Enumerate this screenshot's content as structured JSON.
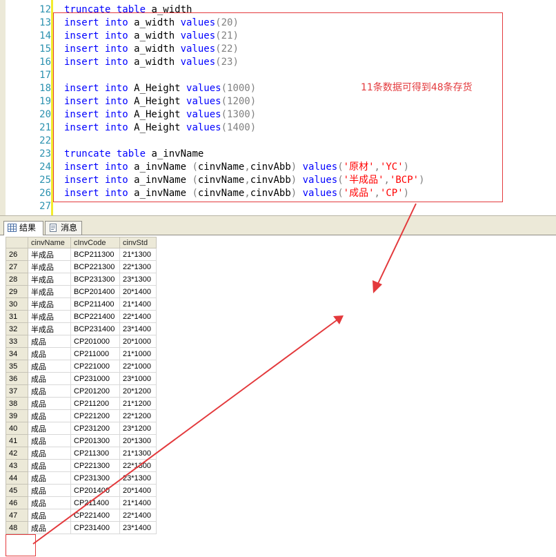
{
  "editor": {
    "lines": [
      {
        "num": "12",
        "parts": [
          {
            "t": "truncate table",
            "c": "kw"
          },
          {
            "t": " a_width",
            "c": ""
          }
        ]
      },
      {
        "num": "13",
        "parts": [
          {
            "t": "insert into",
            "c": "kw"
          },
          {
            "t": " a_width ",
            "c": ""
          },
          {
            "t": "values",
            "c": "kw"
          },
          {
            "t": "(20)",
            "c": "gr"
          }
        ]
      },
      {
        "num": "14",
        "parts": [
          {
            "t": "insert into",
            "c": "kw"
          },
          {
            "t": " a_width ",
            "c": ""
          },
          {
            "t": "values",
            "c": "kw"
          },
          {
            "t": "(21)",
            "c": "gr"
          }
        ]
      },
      {
        "num": "15",
        "parts": [
          {
            "t": "insert into",
            "c": "kw"
          },
          {
            "t": " a_width ",
            "c": ""
          },
          {
            "t": "values",
            "c": "kw"
          },
          {
            "t": "(22)",
            "c": "gr"
          }
        ]
      },
      {
        "num": "16",
        "parts": [
          {
            "t": "insert into",
            "c": "kw"
          },
          {
            "t": " a_width ",
            "c": ""
          },
          {
            "t": "values",
            "c": "kw"
          },
          {
            "t": "(23)",
            "c": "gr"
          }
        ]
      },
      {
        "num": "17",
        "parts": []
      },
      {
        "num": "18",
        "parts": [
          {
            "t": "insert into",
            "c": "kw"
          },
          {
            "t": " A_Height ",
            "c": ""
          },
          {
            "t": "values",
            "c": "kw"
          },
          {
            "t": "(1000)",
            "c": "gr"
          }
        ]
      },
      {
        "num": "19",
        "parts": [
          {
            "t": "insert into",
            "c": "kw"
          },
          {
            "t": " A_Height ",
            "c": ""
          },
          {
            "t": "values",
            "c": "kw"
          },
          {
            "t": "(1200)",
            "c": "gr"
          }
        ]
      },
      {
        "num": "20",
        "parts": [
          {
            "t": "insert into",
            "c": "kw"
          },
          {
            "t": " A_Height ",
            "c": ""
          },
          {
            "t": "values",
            "c": "kw"
          },
          {
            "t": "(1300)",
            "c": "gr"
          }
        ]
      },
      {
        "num": "21",
        "parts": [
          {
            "t": "insert into",
            "c": "kw"
          },
          {
            "t": " A_Height ",
            "c": ""
          },
          {
            "t": "values",
            "c": "kw"
          },
          {
            "t": "(1400)",
            "c": "gr"
          }
        ]
      },
      {
        "num": "22",
        "parts": []
      },
      {
        "num": "23",
        "parts": [
          {
            "t": "truncate table",
            "c": "kw"
          },
          {
            "t": " a_invName",
            "c": ""
          }
        ]
      },
      {
        "num": "24",
        "parts": [
          {
            "t": "insert into",
            "c": "kw"
          },
          {
            "t": " a_invName ",
            "c": ""
          },
          {
            "t": "(",
            "c": "gr"
          },
          {
            "t": "cinvName",
            "c": ""
          },
          {
            "t": ",",
            "c": "gr"
          },
          {
            "t": "cinvAbb",
            "c": ""
          },
          {
            "t": ") ",
            "c": "gr"
          },
          {
            "t": "values",
            "c": "kw"
          },
          {
            "t": "(",
            "c": "gr"
          },
          {
            "t": "'原材'",
            "c": "str"
          },
          {
            "t": ",",
            "c": "gr"
          },
          {
            "t": "'YC'",
            "c": "str"
          },
          {
            "t": ")",
            "c": "gr"
          }
        ]
      },
      {
        "num": "25",
        "parts": [
          {
            "t": "insert into",
            "c": "kw"
          },
          {
            "t": " a_invName ",
            "c": ""
          },
          {
            "t": "(",
            "c": "gr"
          },
          {
            "t": "cinvName",
            "c": ""
          },
          {
            "t": ",",
            "c": "gr"
          },
          {
            "t": "cinvAbb",
            "c": ""
          },
          {
            "t": ") ",
            "c": "gr"
          },
          {
            "t": "values",
            "c": "kw"
          },
          {
            "t": "(",
            "c": "gr"
          },
          {
            "t": "'半成品'",
            "c": "str"
          },
          {
            "t": ",",
            "c": "gr"
          },
          {
            "t": "'BCP'",
            "c": "str"
          },
          {
            "t": ")",
            "c": "gr"
          }
        ]
      },
      {
        "num": "26",
        "parts": [
          {
            "t": "insert into",
            "c": "kw"
          },
          {
            "t": " a_invName ",
            "c": ""
          },
          {
            "t": "(",
            "c": "gr"
          },
          {
            "t": "cinvName",
            "c": ""
          },
          {
            "t": ",",
            "c": "gr"
          },
          {
            "t": "cinvAbb",
            "c": ""
          },
          {
            "t": ") ",
            "c": "gr"
          },
          {
            "t": "values",
            "c": "kw"
          },
          {
            "t": "(",
            "c": "gr"
          },
          {
            "t": "'成品'",
            "c": "str"
          },
          {
            "t": ",",
            "c": "gr"
          },
          {
            "t": "'CP'",
            "c": "str"
          },
          {
            "t": ")",
            "c": "gr"
          }
        ]
      },
      {
        "num": "27",
        "parts": []
      }
    ]
  },
  "tabs": [
    {
      "label": "结果",
      "icon": "grid-icon",
      "active": true
    },
    {
      "label": "消息",
      "icon": "message-icon",
      "active": false
    }
  ],
  "grid": {
    "columns": [
      "cinvName",
      "cInvCode",
      "cinvStd"
    ],
    "rows": [
      [
        "26",
        "半成品",
        "BCP211300",
        "21*1300"
      ],
      [
        "27",
        "半成品",
        "BCP221300",
        "22*1300"
      ],
      [
        "28",
        "半成品",
        "BCP231300",
        "23*1300"
      ],
      [
        "29",
        "半成品",
        "BCP201400",
        "20*1400"
      ],
      [
        "30",
        "半成品",
        "BCP211400",
        "21*1400"
      ],
      [
        "31",
        "半成品",
        "BCP221400",
        "22*1400"
      ],
      [
        "32",
        "半成品",
        "BCP231400",
        "23*1400"
      ],
      [
        "33",
        "成品",
        "CP201000",
        "20*1000"
      ],
      [
        "34",
        "成品",
        "CP211000",
        "21*1000"
      ],
      [
        "35",
        "成品",
        "CP221000",
        "22*1000"
      ],
      [
        "36",
        "成品",
        "CP231000",
        "23*1000"
      ],
      [
        "37",
        "成品",
        "CP201200",
        "20*1200"
      ],
      [
        "38",
        "成品",
        "CP211200",
        "21*1200"
      ],
      [
        "39",
        "成品",
        "CP221200",
        "22*1200"
      ],
      [
        "40",
        "成品",
        "CP231200",
        "23*1200"
      ],
      [
        "41",
        "成品",
        "CP201300",
        "20*1300"
      ],
      [
        "42",
        "成品",
        "CP211300",
        "21*1300"
      ],
      [
        "43",
        "成品",
        "CP221300",
        "22*1300"
      ],
      [
        "44",
        "成品",
        "CP231300",
        "23*1300"
      ],
      [
        "45",
        "成品",
        "CP201400",
        "20*1400"
      ],
      [
        "46",
        "成品",
        "CP211400",
        "21*1400"
      ],
      [
        "47",
        "成品",
        "CP221400",
        "22*1400"
      ],
      [
        "48",
        "成品",
        "CP231400",
        "23*1400"
      ]
    ]
  },
  "annotation": {
    "text": "11条数据可得到48条存货",
    "color": "#e3393c"
  }
}
